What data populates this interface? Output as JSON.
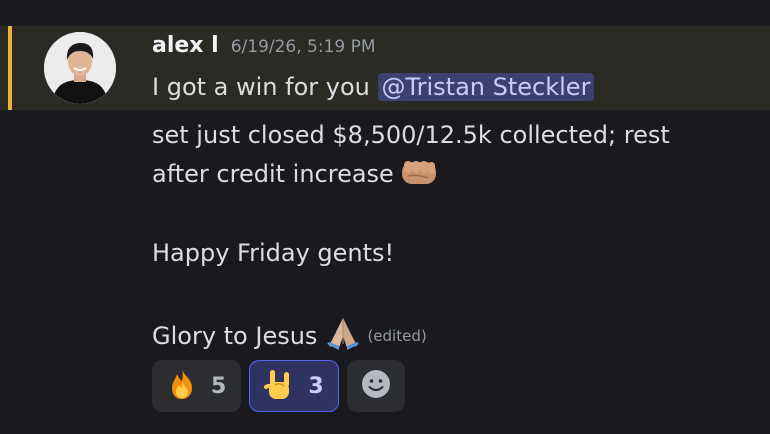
{
  "message": {
    "author": "alex l",
    "timestamp": "6/19/26, 5:19 PM",
    "line1_text": "I got a win for you ",
    "mention": "@Tristan Steckler",
    "line2": "set just closed $8,500/12.5k collected; rest",
    "line3": "after credit increase",
    "line4": "Happy Friday gents!",
    "line5": "Glory to Jesus",
    "edited_label": "(edited)",
    "emoji_after_line3": "oncoming-fist-icon",
    "emoji_after_line5": "folded-hands-icon"
  },
  "reactions": [
    {
      "emoji": "fire-icon",
      "count": "5",
      "selected": false
    },
    {
      "emoji": "sign-of-the-horns-icon",
      "count": "3",
      "selected": true
    }
  ],
  "add_reaction_icon": "smiley-add-reaction-icon",
  "colors": {
    "background": "#1a1a1e",
    "mention_highlight": "#2c2a24",
    "mention_bar": "#f0b232",
    "mention_pill": "#3c4270",
    "reaction_selected_border": "#5865f2"
  }
}
